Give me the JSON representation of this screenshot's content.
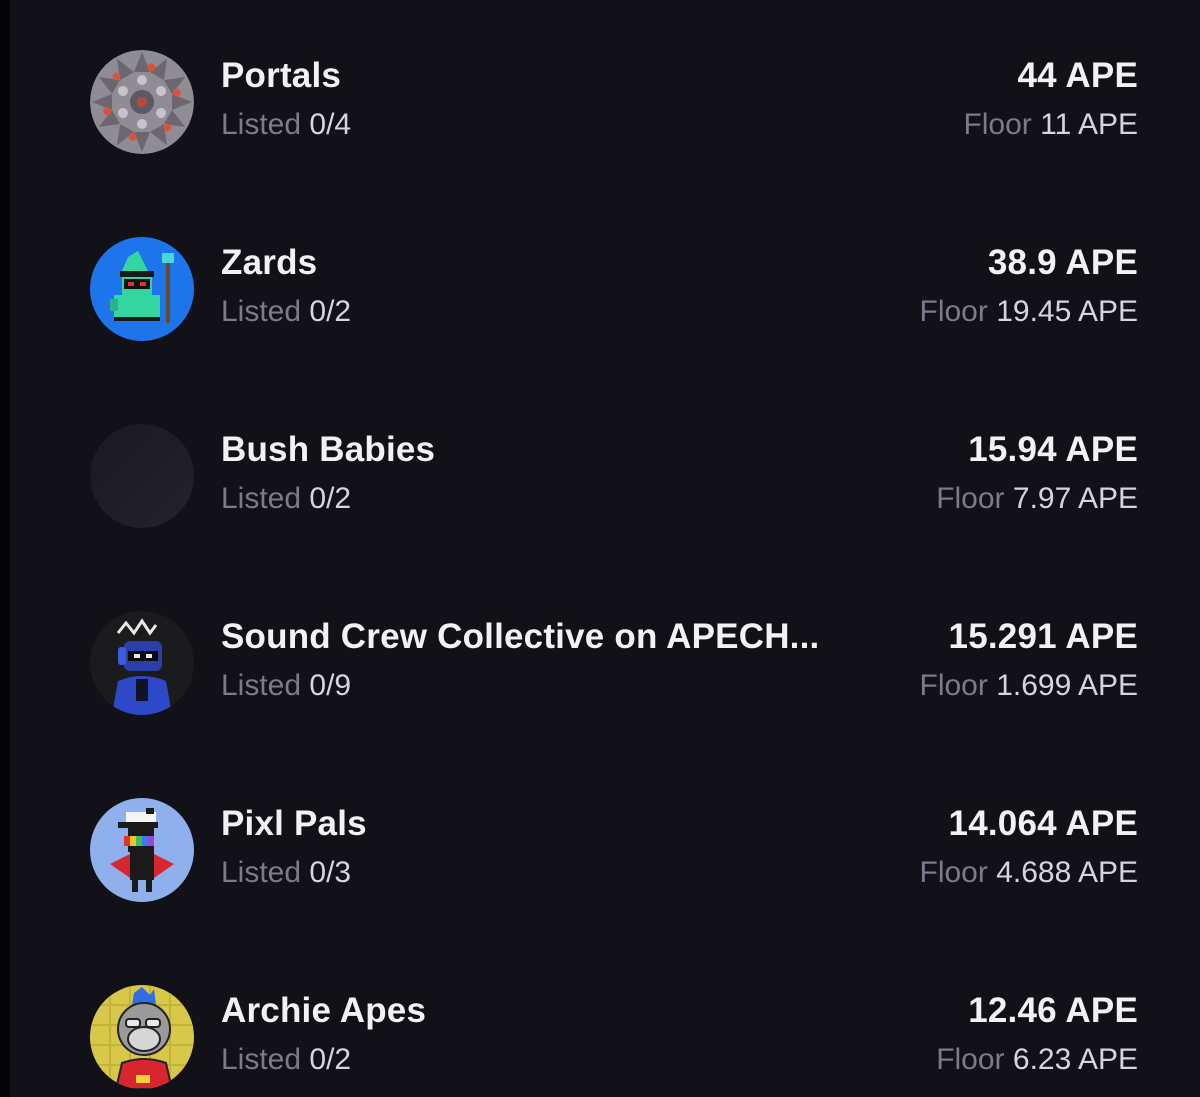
{
  "colors": {
    "background": "#121118",
    "primary_text": "#f2f1f5",
    "muted_text": "#7d7a8a",
    "value_text": "#d6d4de"
  },
  "collections": [
    {
      "name": "Portals",
      "listed_label": "Listed",
      "listed": "0/4",
      "price": "44 APE",
      "floor_label": "Floor",
      "floor": "11 APE",
      "avatar": "portals-kaleidoscope-avatar"
    },
    {
      "name": "Zards",
      "listed_label": "Listed",
      "listed": "0/2",
      "price": "38.9 APE",
      "floor_label": "Floor",
      "floor": "19.45 APE",
      "avatar": "zards-wizard-avatar"
    },
    {
      "name": "Bush Babies",
      "listed_label": "Listed",
      "listed": "0/2",
      "price": "15.94 APE",
      "floor_label": "Floor",
      "floor": "7.97 APE",
      "avatar": "bush-babies-blank-avatar"
    },
    {
      "name": "Sound Crew Collective on APECH...",
      "listed_label": "Listed",
      "listed": "0/9",
      "price": "15.291 APE",
      "floor_label": "Floor",
      "floor": "1.699 APE",
      "avatar": "sound-crew-avatar"
    },
    {
      "name": "Pixl Pals",
      "listed_label": "Listed",
      "listed": "0/3",
      "price": "14.064 APE",
      "floor_label": "Floor",
      "floor": "4.688 APE",
      "avatar": "pixl-pals-avatar"
    },
    {
      "name": "Archie Apes",
      "listed_label": "Listed",
      "listed": "0/2",
      "price": "12.46 APE",
      "floor_label": "Floor",
      "floor": "6.23 APE",
      "avatar": "archie-apes-avatar"
    }
  ]
}
